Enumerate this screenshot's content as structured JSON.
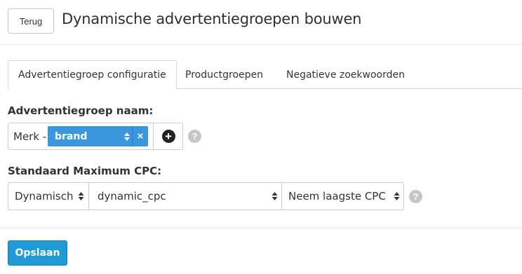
{
  "header": {
    "back_label": "Terug",
    "title": "Dynamische advertentiegroepen bouwen"
  },
  "tabs": [
    {
      "label": "Advertentiegroep configuratie",
      "active": true
    },
    {
      "label": "Productgroepen",
      "active": false
    },
    {
      "label": "Negatieve zoekwoorden",
      "active": false
    }
  ],
  "ad_group_name": {
    "label": "Advertentiegroep naam:",
    "prefix": "Merk -",
    "chip_value": "brand",
    "remove_glyph": "×",
    "add_glyph": "+",
    "help_glyph": "?"
  },
  "max_cpc": {
    "label": "Standaard Maximum CPC:",
    "mode_value": "Dynamisch",
    "source_value": "dynamic_cpc",
    "rule_value": "Neem laagste CPC",
    "help_glyph": "?"
  },
  "footer": {
    "save_label": "Opslaan"
  },
  "colors": {
    "chip": "#3a97dd",
    "primary_button": "#1e9ad6",
    "help": "#c6c6c6"
  },
  "icons": {
    "sort": "sort-icon",
    "remove": "close-icon",
    "add": "plus-circle-icon",
    "help": "question-circle-icon"
  }
}
